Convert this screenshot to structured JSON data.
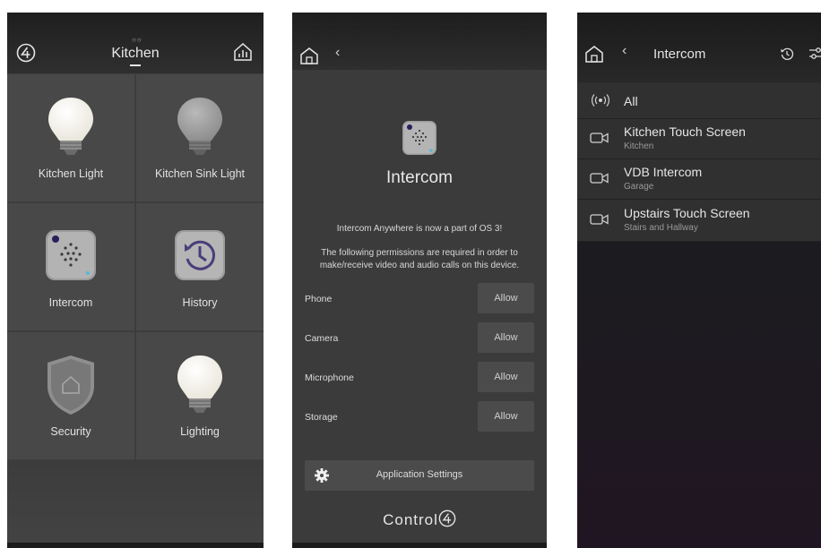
{
  "panel1": {
    "title": "Kitchen",
    "page_dots": "○○",
    "tiles": [
      {
        "label": "Kitchen Light",
        "icon": "light-bulb-on-icon"
      },
      {
        "label": "Kitchen Sink Light",
        "icon": "light-bulb-off-icon"
      },
      {
        "label": "Intercom",
        "icon": "intercom-speaker-icon"
      },
      {
        "label": "History",
        "icon": "history-clock-icon"
      },
      {
        "label": "Security",
        "icon": "security-shield-icon"
      },
      {
        "label": "Lighting",
        "icon": "light-bulb-on-icon"
      }
    ]
  },
  "panel2": {
    "back_glyph": "‹",
    "title": "Intercom",
    "notice": "Intercom Anywhere is now a part of OS 3!",
    "permissions_text_1": "The following permissions are required in order to",
    "permissions_text_2": "make/receive video and audio calls on this device.",
    "permissions": [
      {
        "label": "Phone",
        "button": "Allow"
      },
      {
        "label": "Camera",
        "button": "Allow"
      },
      {
        "label": "Microphone",
        "button": "Allow"
      },
      {
        "label": "Storage",
        "button": "Allow"
      }
    ],
    "app_settings_label": "Application Settings",
    "brand_text": "Control"
  },
  "panel3": {
    "back_glyph": "‹",
    "title": "Intercom",
    "all_label": "All",
    "devices": [
      {
        "name": "Kitchen Touch Screen",
        "location": "Kitchen"
      },
      {
        "name": "VDB Intercom",
        "location": "Garage"
      },
      {
        "name": "Upstairs Touch Screen",
        "location": "Stairs and Hallway"
      }
    ]
  }
}
